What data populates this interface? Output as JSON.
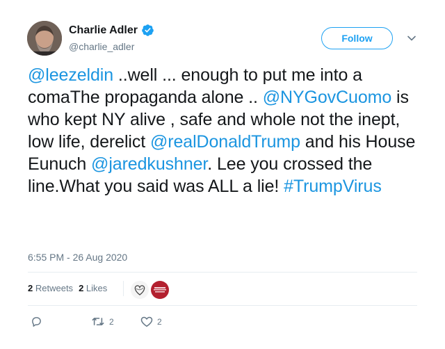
{
  "user": {
    "name": "Charlie Adler",
    "handle": "@charlie_adler",
    "verified": true
  },
  "follow_label": "Follow",
  "tweet": {
    "segments": [
      {
        "text": "@leezeldin",
        "type": "mention"
      },
      {
        "text": " ..well ... enough to put me into a comaThe propaganda alone .. ",
        "type": "text"
      },
      {
        "text": "@NYGovCuomo",
        "type": "mention"
      },
      {
        "text": " is who kept NY alive , safe and whole not the inept,  low life, derelict ",
        "type": "text"
      },
      {
        "text": "@realDonaldTrump",
        "type": "mention"
      },
      {
        "text": " and his House Eunuch ",
        "type": "text"
      },
      {
        "text": "@jaredkushner",
        "type": "mention"
      },
      {
        "text": ".  Lee you crossed the line.What you said was ALL a lie! ",
        "type": "text"
      },
      {
        "text": "#TrumpVirus",
        "type": "hashtag"
      }
    ]
  },
  "timestamp": "6:55 PM - 26 Aug 2020",
  "stats": {
    "retweets_count": "2",
    "retweets_label": "Retweets",
    "likes_count": "2",
    "likes_label": "Likes"
  },
  "actions": {
    "reply_icon": "reply-icon",
    "retweet_icon": "retweet-icon",
    "retweet_count": "2",
    "like_icon": "heart-icon",
    "like_count": "2"
  },
  "colors": {
    "link": "#1b95e0",
    "accent": "#1da1f2",
    "secondary_text": "#657786",
    "primary_text": "#14171a"
  }
}
